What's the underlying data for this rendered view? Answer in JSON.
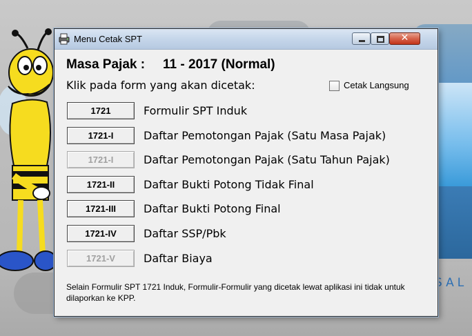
{
  "window": {
    "title": "Menu Cetak SPT",
    "close_glyph": "✕"
  },
  "header": {
    "masa_label": "Masa Pajak :",
    "masa_value": "11 - 2017 (Normal)"
  },
  "instruction": "Klik pada form yang akan dicetak:",
  "cetak_langsung": {
    "label": "Cetak Langsung",
    "checked": false
  },
  "forms": [
    {
      "code": "1721",
      "description": "Formulir SPT Induk",
      "enabled": true
    },
    {
      "code": "1721-I",
      "description": "Daftar Pemotongan Pajak (Satu Masa Pajak)",
      "enabled": true
    },
    {
      "code": "1721-I",
      "description": "Daftar Pemotongan Pajak (Satu Tahun Pajak)",
      "enabled": false
    },
    {
      "code": "1721-II",
      "description": "Daftar Bukti Potong Tidak Final",
      "enabled": true
    },
    {
      "code": "1721-III",
      "description": "Daftar Bukti Potong Final",
      "enabled": true
    },
    {
      "code": "1721-IV",
      "description": "Daftar SSP/Pbk",
      "enabled": true
    },
    {
      "code": "1721-V",
      "description": "Daftar Biaya",
      "enabled": false
    }
  ],
  "footer_note": "Selain Formulir SPT 1721 Induk, Formulir-Formulir yang dicetak lewat aplikasi ini tidak untuk dilaporkan ke KPP.",
  "background": {
    "text": "SAL",
    "mascot": "bee-mascot"
  }
}
